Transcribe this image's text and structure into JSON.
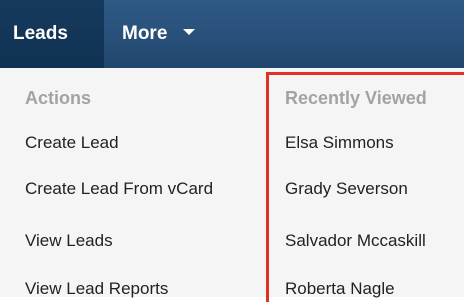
{
  "navbar": {
    "tabs": [
      {
        "label": "Leads"
      },
      {
        "label": "More"
      }
    ]
  },
  "actions": {
    "header": "Actions",
    "items": [
      {
        "label": "Create Lead"
      },
      {
        "label": "Create Lead From vCard"
      },
      {
        "label": "View Leads"
      },
      {
        "label": "View Lead Reports"
      }
    ]
  },
  "recently_viewed": {
    "header": "Recently Viewed",
    "items": [
      {
        "label": "Elsa Simmons"
      },
      {
        "label": "Grady Severson"
      },
      {
        "label": "Salvador Mccaskill"
      },
      {
        "label": "Roberta Nagle"
      }
    ]
  },
  "colors": {
    "navbar": "#22476e",
    "active_tab": "#103252",
    "highlight": "#e03328",
    "header_text": "#a3a3a3"
  }
}
